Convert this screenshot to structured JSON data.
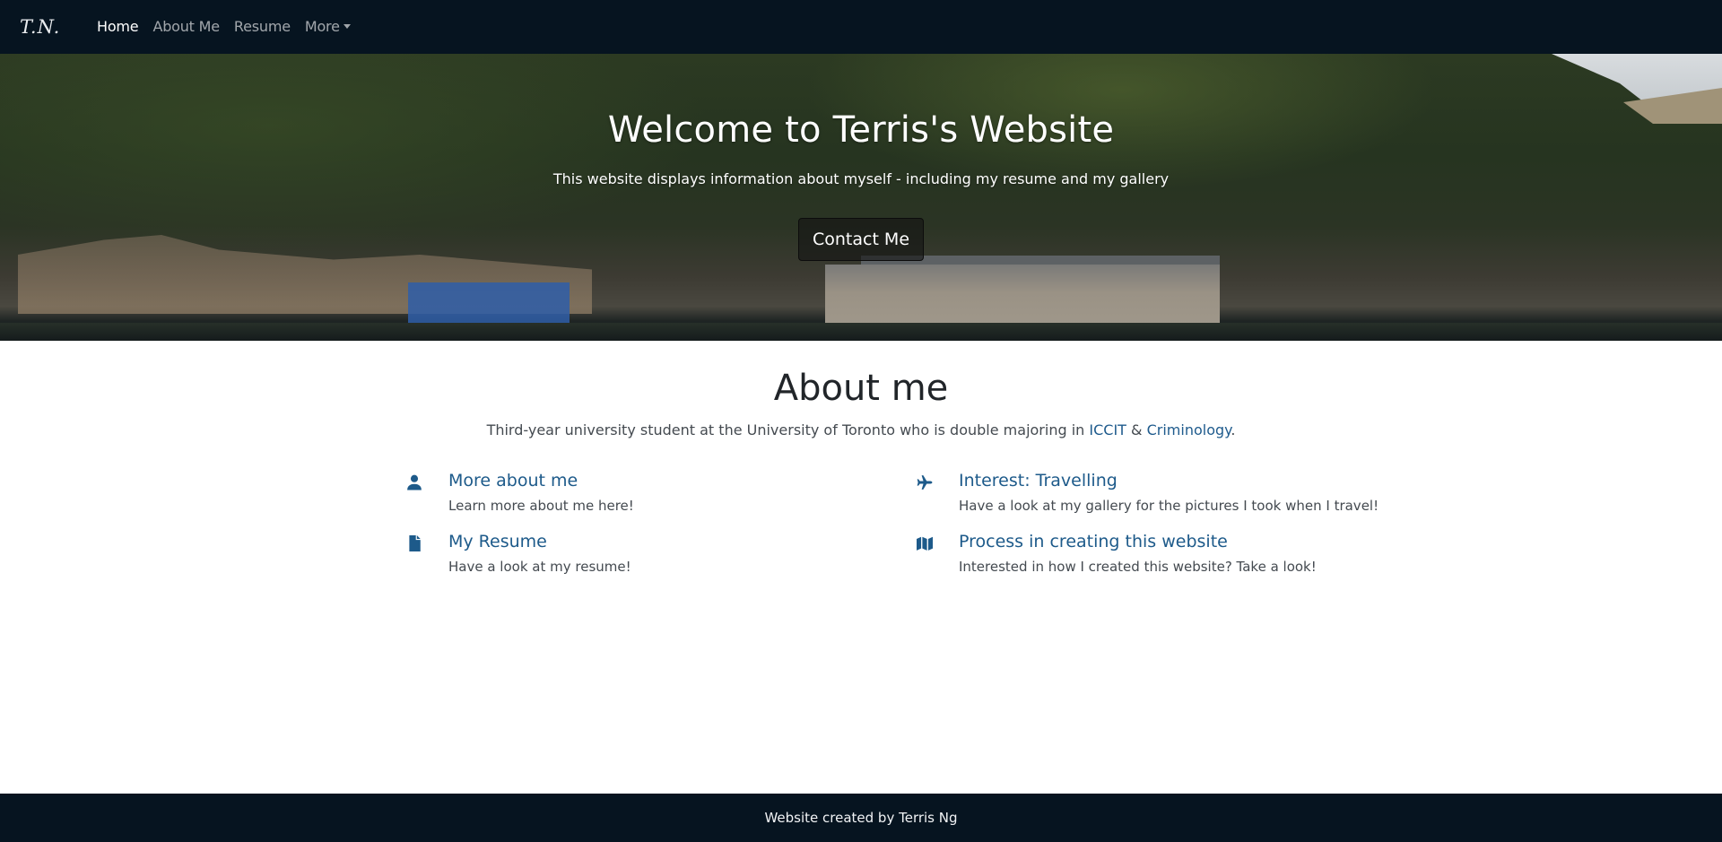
{
  "navbar": {
    "brand": "T.N.",
    "links": [
      {
        "label": "Home",
        "active": true
      },
      {
        "label": "About Me",
        "active": false
      },
      {
        "label": "Resume",
        "active": false
      },
      {
        "label": "More",
        "active": false,
        "dropdown": true
      }
    ]
  },
  "hero": {
    "title": "Welcome to Terris's Website",
    "subtitle": "This website displays information about myself - including my resume and my gallery",
    "button_label": "Contact Me"
  },
  "about": {
    "title": "About me",
    "text_before": "Third-year university student at the University of Toronto who is double majoring in ",
    "link1": "ICCIT",
    "text_between": " & ",
    "link2": "Criminology",
    "text_after": ".",
    "features": [
      {
        "icon": "user-icon",
        "title": "More about me",
        "description": "Learn more about me here!"
      },
      {
        "icon": "file-icon",
        "title": "My Resume",
        "description": "Have a look at my resume!"
      },
      {
        "icon": "plane-icon",
        "title": "Interest: Travelling",
        "description": "Have a look at my gallery for the pictures I took when I travel!"
      },
      {
        "icon": "map-icon",
        "title": "Process in creating this website",
        "description": "Interested in how I created this website? Take a look!"
      }
    ]
  },
  "footer": {
    "text": "Website created by Terris Ng"
  },
  "colors": {
    "navbar_bg": "#061420",
    "accent": "#1d5a8a",
    "body_text": "#444a50"
  }
}
